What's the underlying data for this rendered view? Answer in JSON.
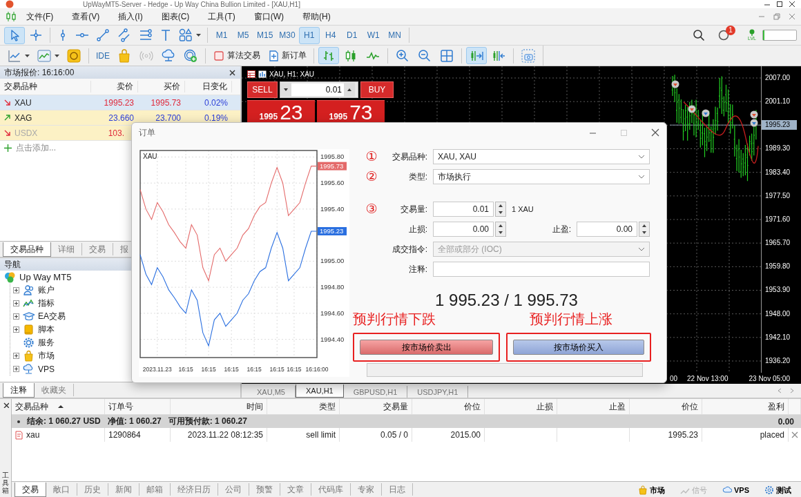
{
  "window": {
    "title": "UpWayMT5-Server - Hedge - Up Way China Bullion Limited - [XAU,H1]"
  },
  "menu": [
    "文件(F)",
    "查看(V)",
    "插入(I)",
    "图表(C)",
    "工具(T)",
    "窗口(W)",
    "帮助(H)"
  ],
  "drawing_tools": [
    {
      "selected": true
    },
    {
      "selected": false
    },
    {
      "selected": false
    },
    {
      "selected": false
    },
    {
      "selected": false
    },
    {
      "selected": false
    },
    {
      "selected": false
    },
    {
      "selected": false
    },
    {
      "selected": false
    }
  ],
  "timeframes": [
    {
      "label": "M1",
      "selected": false
    },
    {
      "label": "M5",
      "selected": false
    },
    {
      "label": "M15",
      "selected": false
    },
    {
      "label": "M30",
      "selected": false
    },
    {
      "label": "H1",
      "selected": true
    },
    {
      "label": "H4",
      "selected": false
    },
    {
      "label": "D1",
      "selected": false
    },
    {
      "label": "W1",
      "selected": false
    },
    {
      "label": "MN",
      "selected": false
    }
  ],
  "notifications": {
    "count": "1"
  },
  "account_level": {
    "label": "LVL"
  },
  "level_meter": {
    "level": 0.05
  },
  "toolbar_2": [
    {
      "kind": "icon",
      "selected": false
    },
    {
      "kind": "icon",
      "selected": false
    },
    {
      "kind": "icon",
      "selected": false
    },
    {
      "kind": "separator"
    },
    {
      "kind": "text",
      "label": "IDE",
      "selected": false
    },
    {
      "kind": "icon",
      "selected": false
    },
    {
      "kind": "icon",
      "selected": false
    },
    {
      "kind": "icon",
      "selected": false
    },
    {
      "kind": "icon",
      "selected": false
    },
    {
      "kind": "separator"
    },
    {
      "kind": "button",
      "label": "算法交易",
      "selected": false
    },
    {
      "kind": "button",
      "label": "新订单",
      "selected": false
    },
    {
      "kind": "separator"
    },
    {
      "kind": "icon",
      "selected": true
    },
    {
      "kind": "icon",
      "selected": false
    },
    {
      "kind": "icon",
      "selected": false
    },
    {
      "kind": "separator"
    },
    {
      "kind": "icon",
      "selected": false
    },
    {
      "kind": "icon",
      "selected": false
    },
    {
      "kind": "icon",
      "selected": false
    },
    {
      "kind": "separator"
    },
    {
      "kind": "icon",
      "selected": true
    },
    {
      "kind": "icon",
      "selected": false
    },
    {
      "kind": "separator"
    },
    {
      "kind": "icon",
      "selected": false
    }
  ],
  "market_watch": {
    "title": "市场报价: 16:16:00",
    "columns": [
      "交易品种",
      "卖价",
      "买价",
      "日变化"
    ],
    "rows": [
      {
        "symbol": "XAU",
        "bid": "1995.23",
        "ask": "1995.73",
        "change": "0.02%",
        "rising": false,
        "selected": true,
        "disabled": false
      },
      {
        "symbol": "XAG",
        "bid": "23.660",
        "ask": "23.700",
        "change": "0.19%",
        "rising": true,
        "selected": false,
        "disabled": false
      },
      {
        "symbol": "USDX",
        "bid": "103.",
        "rising": false,
        "selected": false,
        "disabled": true
      }
    ],
    "add_row": "点击添加...",
    "tabs": [
      {
        "label": "交易品种",
        "selected": true
      },
      {
        "label": "详细",
        "selected": false
      },
      {
        "label": "交易",
        "selected": false
      },
      {
        "label": "报",
        "selected": false
      }
    ]
  },
  "navigator": {
    "title": "导航",
    "tree": [
      {
        "label": "Up Way MT5",
        "expandable": false,
        "children": [
          {
            "label": "账户",
            "expandable": true
          },
          {
            "label": "指标",
            "expandable": true
          },
          {
            "label": "EA交易",
            "expandable": true
          },
          {
            "label": "脚本",
            "expandable": true
          },
          {
            "label": "服务",
            "expandable": false
          },
          {
            "label": "市场",
            "expandable": true
          },
          {
            "label": "VPS",
            "expandable": true
          }
        ]
      }
    ],
    "tabs": [
      {
        "label": "注释",
        "selected": true
      },
      {
        "label": "收藏夹",
        "selected": false
      }
    ]
  },
  "chart": {
    "title": "XAU, H1: XAU",
    "one_click": {
      "sell_label": "SELL",
      "buy_label": "BUY",
      "volume": "0.01",
      "bid_prefix": "1995",
      "bid_digits": "23",
      "ask_prefix": "1995",
      "ask_digits": "73"
    },
    "price_labels": [
      {
        "text": "2007.00",
        "current": false
      },
      {
        "text": "2001.10",
        "current": false
      },
      {
        "text": "1995.23",
        "current": true
      },
      {
        "text": "1989.30",
        "current": false
      },
      {
        "text": "1983.40",
        "current": false
      },
      {
        "text": "1977.50",
        "current": false
      },
      {
        "text": "1971.60",
        "current": false
      },
      {
        "text": "1965.70",
        "current": false
      },
      {
        "text": "1959.80",
        "current": false
      },
      {
        "text": "1953.90",
        "current": false
      },
      {
        "text": "1948.00",
        "current": false
      },
      {
        "text": "1942.10",
        "current": false
      },
      {
        "text": "1936.20",
        "current": false
      }
    ],
    "time_labels": [
      "00",
      "22 Nov 13:00",
      "23 Nov 05:00"
    ],
    "tabs": [
      {
        "label": "XAU,M5",
        "selected": false
      },
      {
        "label": "XAU,H1",
        "selected": true
      },
      {
        "label": "GBPUSD,H1",
        "selected": false
      },
      {
        "label": "USDJPY,H1",
        "selected": false
      }
    ]
  },
  "order_dialog": {
    "title": "订单",
    "chart_data": {
      "type": "line",
      "title": "XAU",
      "grid": true,
      "categories": [
        null,
        null,
        null,
        "2023.11.23",
        null,
        null,
        null,
        null,
        "16:15",
        null,
        null,
        null,
        "16:15",
        null,
        null,
        null,
        "16:15",
        null,
        null,
        null,
        "16:15",
        null,
        null,
        null,
        "16:15",
        null,
        null,
        "16:15",
        null,
        null,
        null,
        "16:16:00"
      ],
      "series": [
        {
          "color": "#e46a6a",
          "values": [
            1995.55,
            1995.4,
            1995.32,
            1995.45,
            1995.38,
            1995.28,
            1995.22,
            1995.15,
            1995.1,
            1995.28,
            1995.2,
            1994.95,
            1994.85,
            1995.05,
            1995.1,
            1995.0,
            1995.05,
            1995.1,
            1995.2,
            1995.25,
            1995.35,
            1995.42,
            1995.45,
            1995.6,
            1995.72,
            1995.6,
            1995.35,
            1995.4,
            1995.45,
            1995.6,
            1995.73,
            1995.73
          ]
        },
        {
          "color": "#2a6fe0",
          "values": [
            1995.05,
            1994.9,
            1994.82,
            1994.95,
            1994.88,
            1994.78,
            1994.72,
            1994.65,
            1994.6,
            1994.78,
            1994.7,
            1994.45,
            1994.35,
            1994.55,
            1994.6,
            1994.5,
            1994.55,
            1994.6,
            1994.7,
            1994.75,
            1994.85,
            1994.92,
            1994.95,
            1995.1,
            1995.22,
            1995.1,
            1994.85,
            1994.9,
            1994.95,
            1995.1,
            1995.23,
            1995.23
          ]
        }
      ],
      "ylim": [
        1994.26,
        1995.85
      ],
      "yticks": [
        {
          "value": 1995.8,
          "label": "1995.80"
        },
        {
          "value": 1995.6,
          "label": "1995.60"
        },
        {
          "value": 1995.4,
          "label": "1995.40"
        },
        {
          "value": 1995.0,
          "label": "1995.00"
        },
        {
          "value": 1994.8,
          "label": "1994.80"
        },
        {
          "value": 1994.6,
          "label": "1994.60"
        },
        {
          "value": 1994.4,
          "label": "1994.40"
        }
      ],
      "annotations": [
        "1995.73",
        "1995.23"
      ]
    },
    "symbol": {
      "marker": "①",
      "label": "交易品种:",
      "value": "XAU, XAU",
      "disabled": false
    },
    "type": {
      "marker": "②",
      "label": "类型:",
      "value": "市场执行",
      "disabled": false
    },
    "volume": {
      "marker": "③",
      "label": "交易量:",
      "value": "0.01",
      "unit": "1 XAU"
    },
    "stop_loss": {
      "label": "止损:",
      "value": "0.00"
    },
    "take_profit": {
      "label": "止盈:",
      "value": "0.00"
    },
    "filling": {
      "label": "成交指令:",
      "value": "全部或部分 (IOC)",
      "disabled": true
    },
    "comment": {
      "label": "注释:"
    },
    "price": "1 995.23 / 1 995.73",
    "sell_hint": "预判行情下跌",
    "buy_hint": "预判行情上涨",
    "sell_button": "按市场价卖出",
    "buy_button": "按市场价买入"
  },
  "toolbox": {
    "title": "工具箱",
    "columns": [
      {
        "label": "交易品种",
        "sorted": true
      },
      {
        "label": "订单号",
        "sorted": false
      },
      {
        "label": "时间",
        "sorted": false
      },
      {
        "label": "类型",
        "sorted": false
      },
      {
        "label": "交易量",
        "sorted": false
      },
      {
        "label": "价位",
        "sorted": false
      },
      {
        "label": "止损",
        "sorted": false
      },
      {
        "label": "止盈",
        "sorted": false
      },
      {
        "label": "价位",
        "sorted": false
      },
      {
        "label": "盈利",
        "sorted": false
      }
    ],
    "summary": {
      "parts": [
        "结余: 1 060.27 USD",
        "净值: 1 060.27",
        "可用预付款: 1 060.27"
      ],
      "profit": "0.00"
    },
    "orders": [
      {
        "symbol": "xau",
        "ticket": "1290864",
        "time": "2023.11.22 08:12:35",
        "type": "sell limit",
        "volume": "0.05 / 0",
        "price": "2015.00",
        "current_price": "1995.23",
        "state": "placed"
      }
    ],
    "tabs": [
      {
        "label": "交易",
        "selected": true
      },
      {
        "label": "敞口",
        "selected": false
      },
      {
        "label": "历史",
        "selected": false
      },
      {
        "label": "新闻",
        "selected": false
      },
      {
        "label": "邮箱",
        "selected": false
      },
      {
        "label": "经济日历",
        "selected": false
      },
      {
        "label": "公司",
        "selected": false
      },
      {
        "label": "预警",
        "selected": false
      },
      {
        "label": "文章",
        "selected": false
      },
      {
        "label": "代码库",
        "selected": false
      },
      {
        "label": "专家",
        "selected": false
      },
      {
        "label": "日志",
        "selected": false
      }
    ],
    "right_tabs": [
      {
        "label": "市场",
        "disabled": false
      },
      {
        "label": "信号",
        "disabled": true
      },
      {
        "label": "VPS",
        "disabled": false
      },
      {
        "label": "测试",
        "disabled": false
      }
    ]
  }
}
